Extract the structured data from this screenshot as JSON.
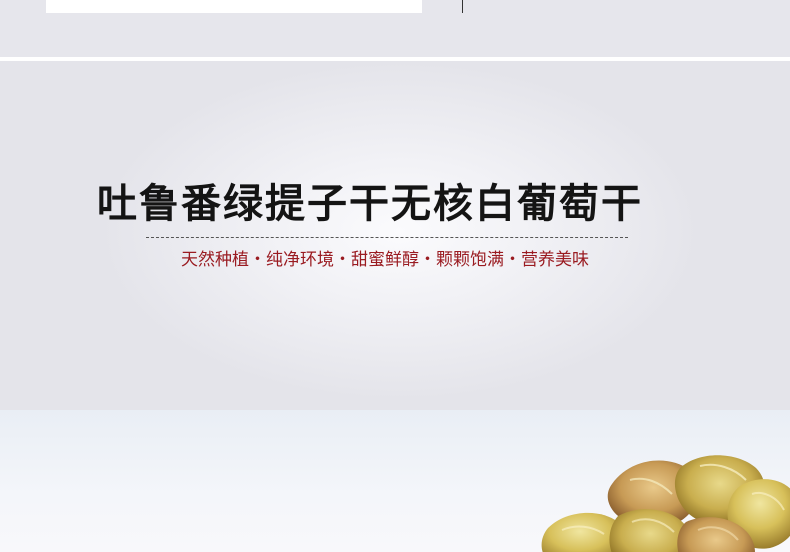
{
  "banner": {
    "headline": "吐鲁番绿提子干无核白葡萄干",
    "tagline": "天然种植・纯净环境・甜蜜鲜醇・颗颗饱满・营养美味"
  },
  "colors": {
    "headline": "#141414",
    "tagline": "#9a1b21",
    "background": "#e6e6ec"
  },
  "product_image": {
    "subject": "golden-raisins"
  }
}
